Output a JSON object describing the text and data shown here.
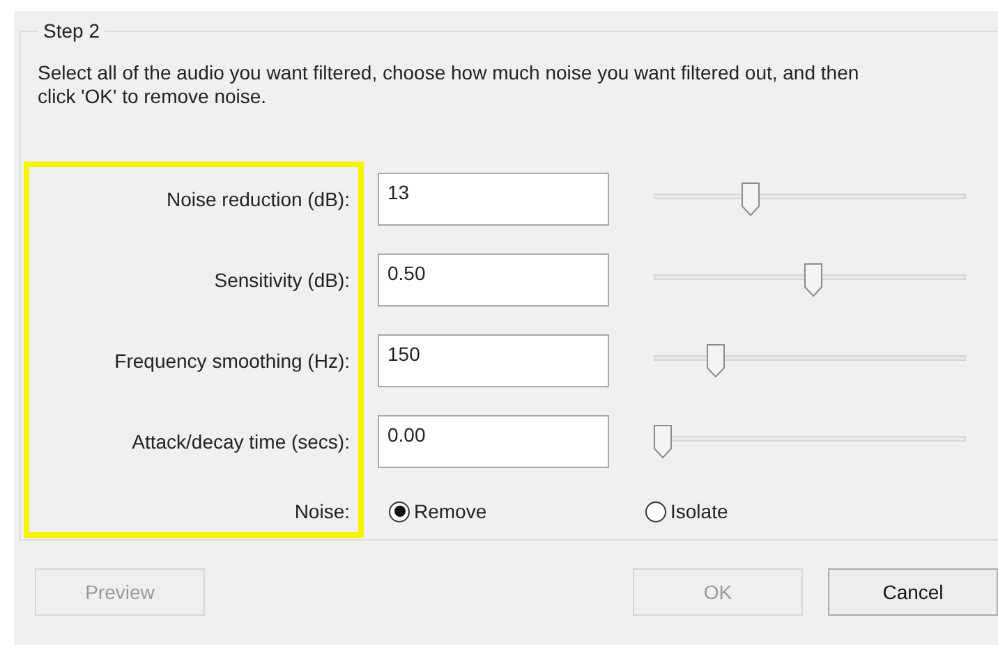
{
  "group": {
    "title": "Step 2"
  },
  "description": "Select all of the audio you want filtered, choose how much noise you want filtered out, and then click 'OK' to remove noise.",
  "parameters": [
    {
      "label": "Noise reduction (dB):",
      "value": "13",
      "level": 0.3
    },
    {
      "label": "Sensitivity (dB):",
      "value": "0.50",
      "level": 0.51
    },
    {
      "label": "Frequency smoothing (Hz):",
      "value": "150",
      "level": 0.18
    },
    {
      "label": "Attack/decay time (secs):",
      "value": "0.00",
      "level": 0.0
    }
  ],
  "noise": {
    "label": "Noise:",
    "options": [
      {
        "label": "Remove",
        "selected": true
      },
      {
        "label": "Isolate",
        "selected": false
      }
    ]
  },
  "buttons": [
    {
      "label": "Preview",
      "disabled": true
    },
    {
      "label": "OK",
      "disabled": true
    },
    {
      "label": "Cancel",
      "disabled": false
    }
  ]
}
